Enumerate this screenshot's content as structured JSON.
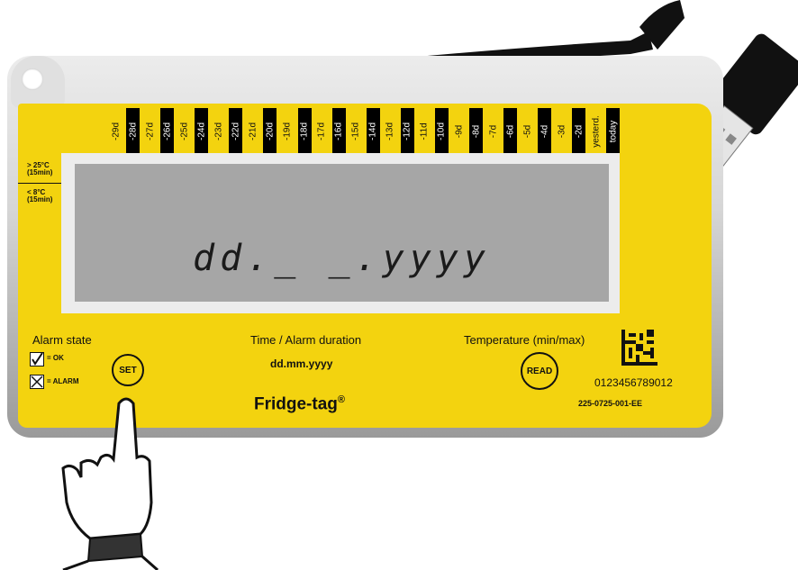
{
  "days": [
    "-29d",
    "-28d",
    "-27d",
    "-26d",
    "-25d",
    "-24d",
    "-23d",
    "-22d",
    "-21d",
    "-20d",
    "-19d",
    "-18d",
    "-17d",
    "-16d",
    "-15d",
    "-14d",
    "-13d",
    "-12d",
    "-11d",
    "-10d",
    "-9d",
    "-8d",
    "-7d",
    "-6d",
    "-5d",
    "-4d",
    "-3d",
    "-2d",
    "yesterd.",
    "today"
  ],
  "side_labels": {
    "high": [
      "> 25°C",
      "(15min)"
    ],
    "low": [
      "<  8°C",
      "(15min)"
    ]
  },
  "lcd_text": "dd._ _.yyyy",
  "alarm_state": {
    "title": "Alarm state",
    "ok_label": "= OK",
    "alarm_label": "= ALARM"
  },
  "set_button": "SET",
  "time_section": {
    "title": "Time / Alarm duration",
    "value": "dd.mm.yyyy"
  },
  "brand": "Fridge-tag",
  "brand_mark": "®",
  "temperature_title": "Temperature (min/max)",
  "read_button": "READ",
  "serial": "0123456789012",
  "part_number": "225-0725-001-EE",
  "icons": [
    "usb-cable-icon",
    "pointing-hand-icon",
    "datamatrix-icon",
    "checkmark-icon",
    "cross-icon"
  ],
  "colors": {
    "label_yellow": "#f3d30f",
    "lcd_gray": "#a6a6a6"
  }
}
